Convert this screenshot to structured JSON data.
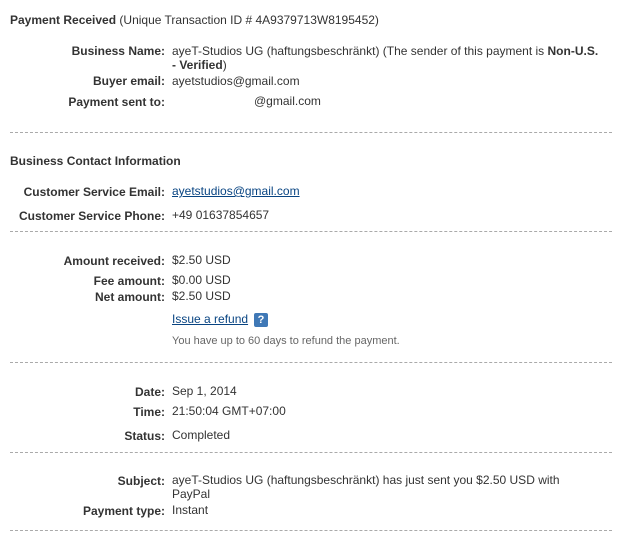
{
  "header": {
    "title": "Payment Received",
    "transaction": "(Unique Transaction ID # 4A9379713W8195452)"
  },
  "payment": {
    "business_name_label": "Business Name:",
    "business_name_part1": "ayeT-Studios UG (haftungsbeschränkt) (The sender of this payment is ",
    "business_name_status": "Non-U.S.",
    "business_name_line2_bold": "- Verified",
    "business_name_line2_tail": ")",
    "buyer_email_label": "Buyer email:",
    "buyer_email_value": "ayetstudios@gmail.com",
    "sent_to_label": "Payment sent to:",
    "sent_to_value": "@gmail.com"
  },
  "contact": {
    "section_title": "Business Contact Information",
    "email_label": "Customer Service Email:",
    "email_value": "ayetstudios@gmail.com",
    "phone_label": "Customer Service Phone:",
    "phone_value": "+49 01637854657"
  },
  "amounts": {
    "received_label": "Amount received:",
    "received_value": "$2.50 USD",
    "fee_label": "Fee amount:",
    "fee_value": "$0.00 USD",
    "net_label": "Net amount:",
    "net_value": "$2.50 USD",
    "refund_link": "Issue a refund",
    "help_icon_glyph": "?",
    "refund_hint": "You have up to 60 days to refund the payment."
  },
  "details": {
    "date_label": "Date:",
    "date_value": "Sep 1, 2014",
    "time_label": "Time:",
    "time_value": "21:50:04 GMT+07:00",
    "status_label": "Status:",
    "status_value": "Completed"
  },
  "subject": {
    "subject_label": "Subject:",
    "subject_line1": "ayeT-Studios UG (haftungsbeschränkt) has just sent you $2.50 USD with",
    "subject_line2": "PayPal",
    "type_label": "Payment type:",
    "type_value": "Instant"
  },
  "colors": {
    "link": "#084482",
    "help_icon": "#3f78b6",
    "divider": "#aaaaaa"
  }
}
